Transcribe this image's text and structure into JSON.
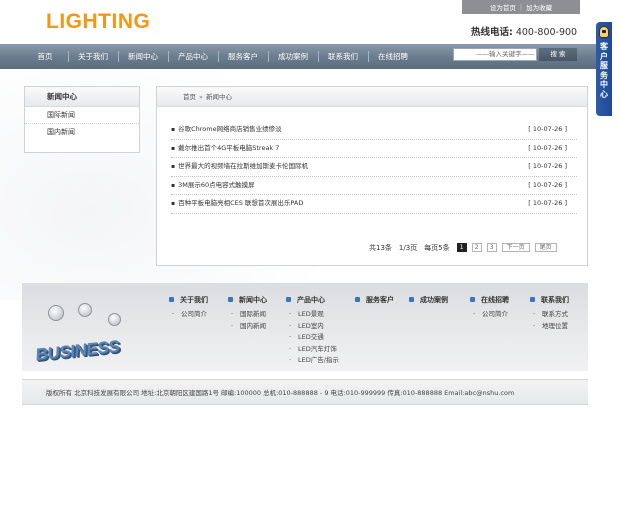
{
  "header": {
    "logo": "LIGHTING",
    "top_links": [
      "设为首页",
      "加为收藏"
    ],
    "hotline_label": "热线电话:",
    "hotline_number": "400-800-900",
    "search_placeholder": "——输入关键字——",
    "search_button": "搜 索",
    "side_tab": "客户服务中心"
  },
  "nav": [
    "首页",
    "关于我们",
    "新闻中心",
    "产品中心",
    "服务客户",
    "成功案例",
    "联系我们",
    "在线招聘"
  ],
  "sidebar": {
    "title": "新闻中心",
    "items": [
      "国际新闻",
      "国内新闻"
    ]
  },
  "main": {
    "breadcrumb_home": "首页",
    "breadcrumb_arrow": "»",
    "breadcrumb_current": "新闻中心",
    "news": [
      {
        "title": "谷歌Chrome网络商店销售业绩惨淡",
        "date": "[ 10-07-26 ]"
      },
      {
        "title": "戴尔推出首个4G平板电脑Streak 7",
        "date": "[ 10-07-26 ]"
      },
      {
        "title": "世界最大的视频墙在拉斯维加斯麦卡伦国际机",
        "date": "[ 10-07-26 ]"
      },
      {
        "title": "3M展示60点电容式触摸屏",
        "date": "[ 10-07-26 ]"
      },
      {
        "title": "百种平板电脑亮相CES 联想首次展出乐PAD",
        "date": "[ 10-07-26 ]"
      }
    ],
    "pager": {
      "total": "共13条",
      "page": "1/3页",
      "per_page": "每页5条",
      "pages": [
        "1",
        "2",
        "3"
      ],
      "next": "下一页",
      "last": "尾页"
    }
  },
  "footer": {
    "logo_text": "BUSINESS",
    "columns": [
      {
        "head": "关于我们",
        "items": [
          "公司简介"
        ]
      },
      {
        "head": "新闻中心",
        "items": [
          "国际新闻",
          "国内新闻"
        ]
      },
      {
        "head": "产品中心",
        "items": [
          "LED景观",
          "LED室内",
          "LED交通",
          "LED汽车灯饰",
          "LED广告/指示"
        ]
      },
      {
        "head": "服务客户",
        "items": []
      },
      {
        "head": "成功案例",
        "items": []
      },
      {
        "head": "在线招聘",
        "items": [
          "公司简介"
        ]
      },
      {
        "head": "联系我们",
        "items": [
          "联系方式",
          "地理位置"
        ]
      }
    ],
    "copyright": "版权所有  北京科技发展有限公司 地址:北京朝阳区建国路1号 邮编:100000   总机:010-888888 - 9 电话:010-999999 传真:010-888888 Email:abc@nshu.com"
  },
  "colors": {
    "logo": "#f39812",
    "nav_bg": "#6c7d8f",
    "side_tab": "#2d5aa6"
  }
}
